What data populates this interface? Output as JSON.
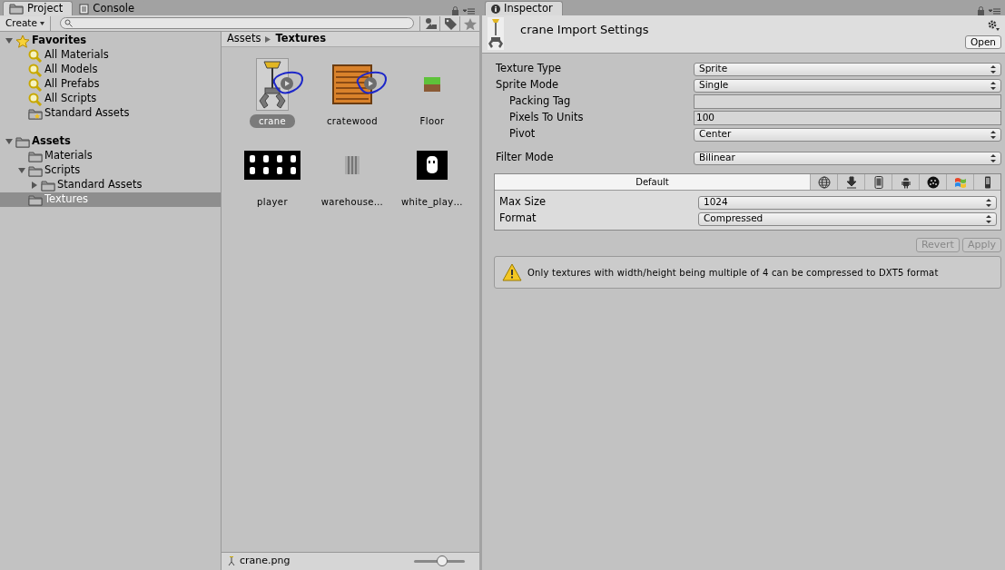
{
  "project_window": {
    "tabs": [
      {
        "label": "Project",
        "selected": true
      },
      {
        "label": "Console",
        "selected": false
      }
    ],
    "toolbar": {
      "create_label": "Create"
    },
    "tree": [
      {
        "label": "Favorites",
        "kind": "favorites",
        "expanded": true,
        "children": [
          {
            "label": "All Materials",
            "kind": "search"
          },
          {
            "label": "All Models",
            "kind": "search"
          },
          {
            "label": "All Prefabs",
            "kind": "search"
          },
          {
            "label": "All Scripts",
            "kind": "search"
          },
          {
            "label": "Standard Assets",
            "kind": "starred_folder"
          }
        ]
      },
      {
        "label": "Assets",
        "kind": "folder",
        "expanded": true,
        "children": [
          {
            "label": "Materials",
            "kind": "folder"
          },
          {
            "label": "Scripts",
            "kind": "folder",
            "expanded": true,
            "children": [
              {
                "label": "Standard Assets",
                "kind": "folder",
                "expanded": false
              }
            ]
          },
          {
            "label": "Textures",
            "kind": "folder",
            "selected": true
          }
        ]
      }
    ],
    "breadcrumb": [
      "Assets",
      "Textures"
    ],
    "assets": [
      {
        "name": "crane",
        "kind": "crane",
        "selected": true,
        "play_button": true,
        "circled": true
      },
      {
        "name": "cratewood",
        "kind": "crate",
        "selected": false,
        "play_button": true,
        "circled": true
      },
      {
        "name": "Floor",
        "kind": "grass",
        "selected": false,
        "play_button": false,
        "circled": false
      },
      {
        "name": "player",
        "kind": "sheet",
        "selected": false,
        "play_button": false,
        "circled": false
      },
      {
        "name": "warehouse…",
        "kind": "bars",
        "selected": false,
        "play_button": false,
        "circled": false
      },
      {
        "name": "white_play…",
        "kind": "ghost",
        "selected": false,
        "play_button": false,
        "circled": false
      }
    ],
    "status": {
      "file": "crane.png",
      "zoom": {
        "level": 0.55
      }
    }
  },
  "inspector": {
    "tab": {
      "label": "Inspector",
      "selected": true
    },
    "title": "crane Import Settings",
    "open_label": "Open",
    "fields": [
      {
        "label": "Texture Type",
        "kind": "select",
        "value": "Sprite",
        "indent": false
      },
      {
        "label": "Sprite Mode",
        "kind": "select",
        "value": "Single",
        "indent": false
      },
      {
        "label": "Packing Tag",
        "kind": "text",
        "indent": true
      },
      {
        "label": "Pixels To Units",
        "kind": "text",
        "value": "100",
        "indent": true
      },
      {
        "label": "Pivot",
        "kind": "select",
        "value": "Center",
        "indent": true
      },
      {
        "label": "Filter Mode",
        "kind": "select",
        "value": "Bilinear",
        "indent": false
      }
    ],
    "platforms": [
      {
        "label": "Default",
        "selected": true
      },
      {
        "selected": false
      },
      {
        "selected": false
      },
      {
        "selected": false
      },
      {
        "selected": false
      },
      {
        "selected": false
      },
      {
        "selected": false
      },
      {
        "selected": false
      }
    ],
    "platform_fields": [
      {
        "label": "Max Size",
        "value": "1024"
      },
      {
        "label": "Format",
        "value": "Compressed"
      }
    ],
    "buttons": [
      {
        "label": "Revert",
        "disabled": true
      },
      {
        "label": "Apply",
        "disabled": true
      }
    ],
    "warning": "Only textures with width/height being multiple of 4 can be compressed to DXT5 format"
  }
}
